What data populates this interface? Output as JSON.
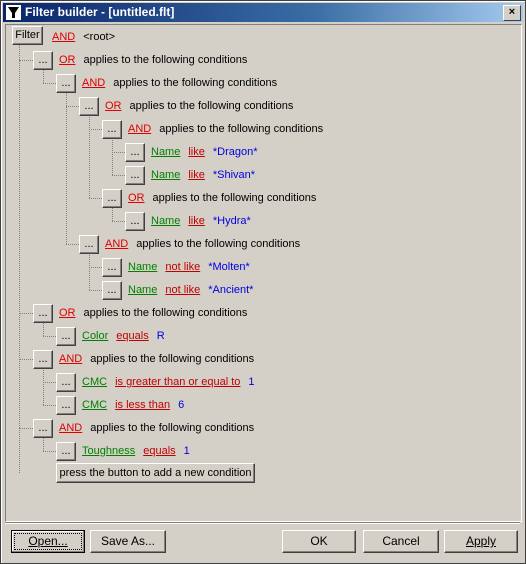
{
  "window": {
    "title": "Filter builder - [untitled.flt]",
    "close_glyph": "×"
  },
  "root": {
    "filter_label": "Filter",
    "op": "AND",
    "text": "<root>"
  },
  "rows": [
    {
      "op": "OR",
      "text": "applies to the following conditions"
    },
    {
      "op": "AND",
      "text": "applies to the following conditions"
    },
    {
      "op": "OR",
      "text": "applies to the following conditions"
    },
    {
      "op": "AND",
      "text": "applies to the following conditions"
    },
    {
      "field": "Name",
      "cmp": "like",
      "value": "*Dragon*"
    },
    {
      "field": "Name",
      "cmp": "like",
      "value": "*Shivan*"
    },
    {
      "op": "OR",
      "text": "applies to the following conditions"
    },
    {
      "field": "Name",
      "cmp": "like",
      "value": "*Hydra*"
    },
    {
      "op": "AND",
      "text": "applies to the following conditions"
    },
    {
      "field": "Name",
      "cmp": "not like",
      "value": "*Molten*"
    },
    {
      "field": "Name",
      "cmp": "not like",
      "value": "*Ancient*"
    },
    {
      "op": "OR",
      "text": "applies to the following conditions"
    },
    {
      "field": "Color",
      "cmp": "equals",
      "value": "R"
    },
    {
      "op": "AND",
      "text": "applies to the following conditions"
    },
    {
      "field": "CMC",
      "cmp": "is greater than or equal to",
      "value": "1"
    },
    {
      "field": "CMC",
      "cmp": "is less than",
      "value": "6"
    },
    {
      "op": "AND",
      "text": "applies to the following conditions"
    },
    {
      "field": "Toughness",
      "cmp": "equals",
      "value": "1"
    }
  ],
  "node_button_label": "...",
  "add_condition_label": "press the button to add a new condition",
  "buttons": {
    "open": "Open...",
    "save_as": "Save As...",
    "ok": "OK",
    "cancel": "Cancel",
    "apply": "Apply"
  }
}
